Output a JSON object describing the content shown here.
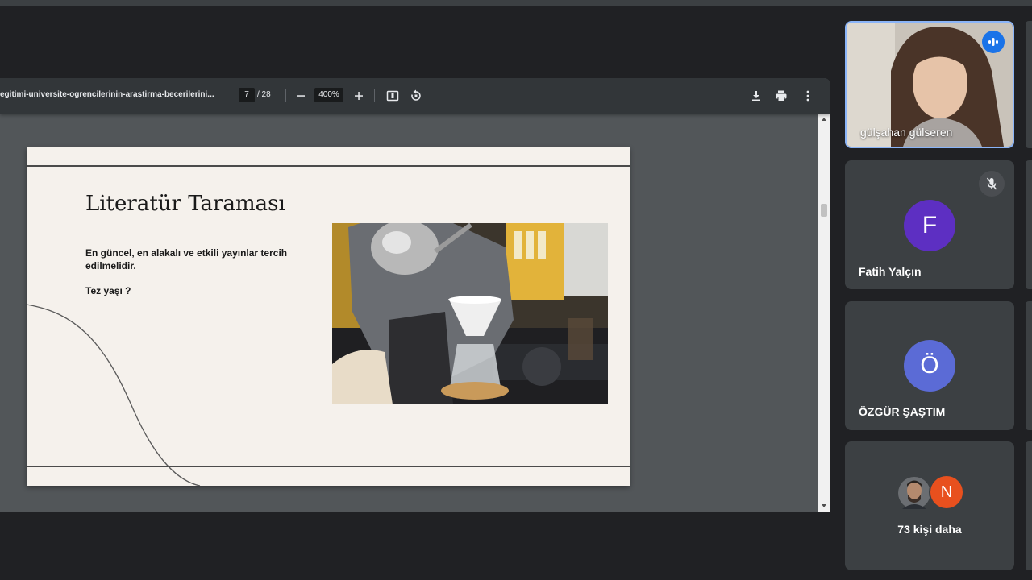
{
  "pdf": {
    "filename": "egitimi-universite-ogrencilerinin-arastirma-becerilerini...",
    "current_page": "7",
    "page_total": "/ 28",
    "zoom": "400%"
  },
  "slide": {
    "title": "Literatür Taraması",
    "body": "En güncel, en alakalı ve etkili yayınlar tercih edilmelidir.",
    "question": "Tez yaşı ?"
  },
  "participants": [
    {
      "name": "gülşahan gülseren",
      "video": true,
      "speaking": true
    },
    {
      "name": "Fatih Yalçın",
      "initial": "F",
      "color": "#5d2fc2",
      "muted": true
    },
    {
      "name": "ÖZGÜR ŞAŞTIM",
      "initial": "Ö",
      "color": "#5b6bd6"
    }
  ],
  "more": {
    "label": "73 kişi daha",
    "initial": "N",
    "color": "#e8501e"
  },
  "icons": {
    "zoom_out": "minus-icon",
    "zoom_in": "plus-icon",
    "fit": "fit-page-icon",
    "rotate": "rotate-icon",
    "download": "download-icon",
    "print": "print-icon",
    "more": "more-vert-icon",
    "speaking": "speaking-indicator-icon",
    "muted": "mic-off-icon"
  },
  "colors": {
    "background": "#202124",
    "tile": "#3c4043",
    "active_border": "#8ab4f8",
    "speaking_badge": "#1a73e8"
  }
}
